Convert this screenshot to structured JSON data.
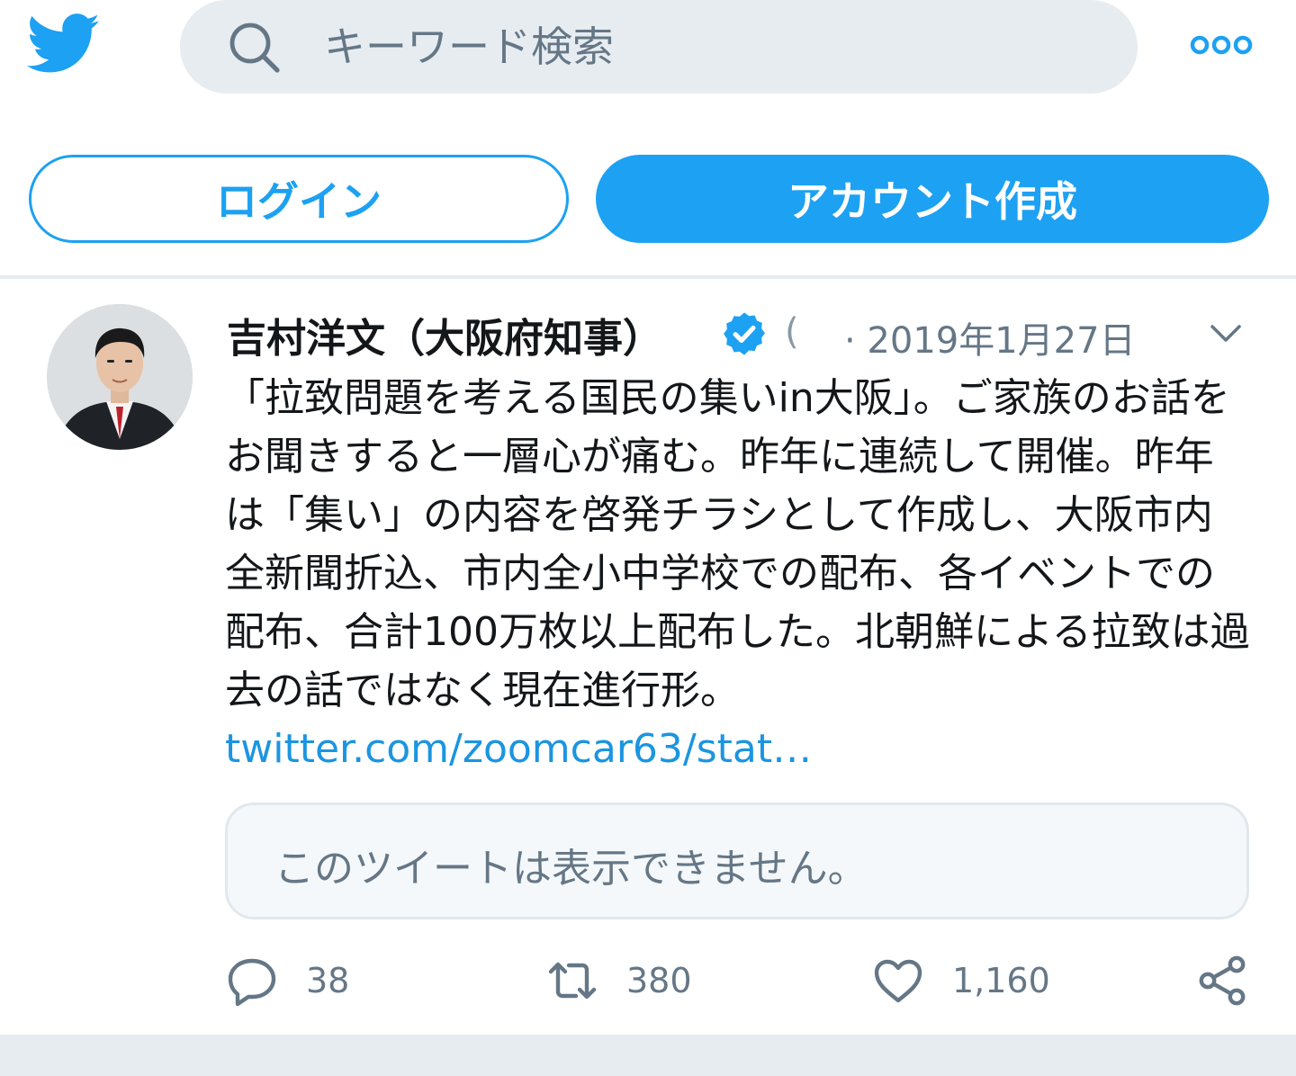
{
  "header": {
    "logo_icon": "twitter-bird-icon",
    "search_placeholder": "キーワード検索",
    "search_icon": "search-icon",
    "more_icon": "more-dots-icon",
    "accent_color": "#1da1f2"
  },
  "auth": {
    "login_label": "ログイン",
    "signup_label": "アカウント作成"
  },
  "tweet": {
    "author_name": "吉村洋文（大阪府知事）",
    "verified_icon": "verified-badge-icon",
    "handle_fragment": "(",
    "date": "· 2019年1月27日",
    "menu_icon": "chevron-down-icon",
    "text": "「拉致問題を考える国民の集いin大阪」。ご家族のお話をお聞きすると一層心が痛む。昨年に連続して開催。昨年は「集い」の内容を啓発チラシとして作成し、大阪市内全新聞折込、市内全小中学校での配布、各イベントでの配布、合計100万枚以上配布した。北朝鮮による拉致は過去の話ではなく現在進行形。",
    "link_text": "twitter.com/zoomcar63/stat…",
    "quoted_unavailable": "このツイートは表示できません。",
    "replies": "38",
    "retweets": "380",
    "likes": "1,160",
    "reply_icon": "reply-icon",
    "retweet_icon": "retweet-icon",
    "like_icon": "heart-icon",
    "share_icon": "share-icon"
  }
}
